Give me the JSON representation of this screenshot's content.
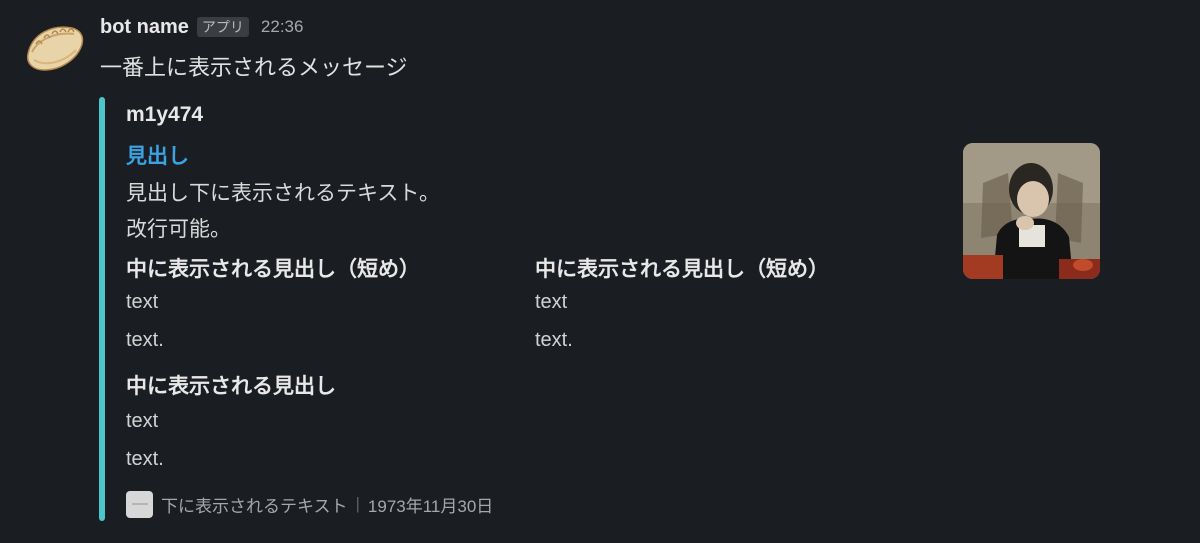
{
  "header": {
    "bot_name": "bot name",
    "app_badge": "アプリ",
    "time": "22:36",
    "avatar_icon": "gyoza-icon"
  },
  "message_text": "一番上に表示されるメッセージ",
  "attachment": {
    "bar_color": "#4bc7c9",
    "author": "m1y474",
    "title": "見出し",
    "title_color": "#3aa3e3",
    "text_lines": [
      "見出し下に表示されるテキスト。",
      "改行可能。"
    ],
    "fields": [
      {
        "title": "中に表示される見出し（短め）",
        "lines": [
          "text",
          "text."
        ]
      },
      {
        "title": "中に表示される見出し（短め）",
        "lines": [
          "text",
          "text."
        ]
      },
      {
        "title": "中に表示される見出し",
        "lines": [
          "text",
          "text."
        ]
      }
    ],
    "thumbnail_icon": "child-photo-thumbnail",
    "footer": {
      "icon": "footer-icon",
      "text": "下に表示されるテキスト",
      "separator": "|",
      "date": "1973年11月30日"
    }
  }
}
